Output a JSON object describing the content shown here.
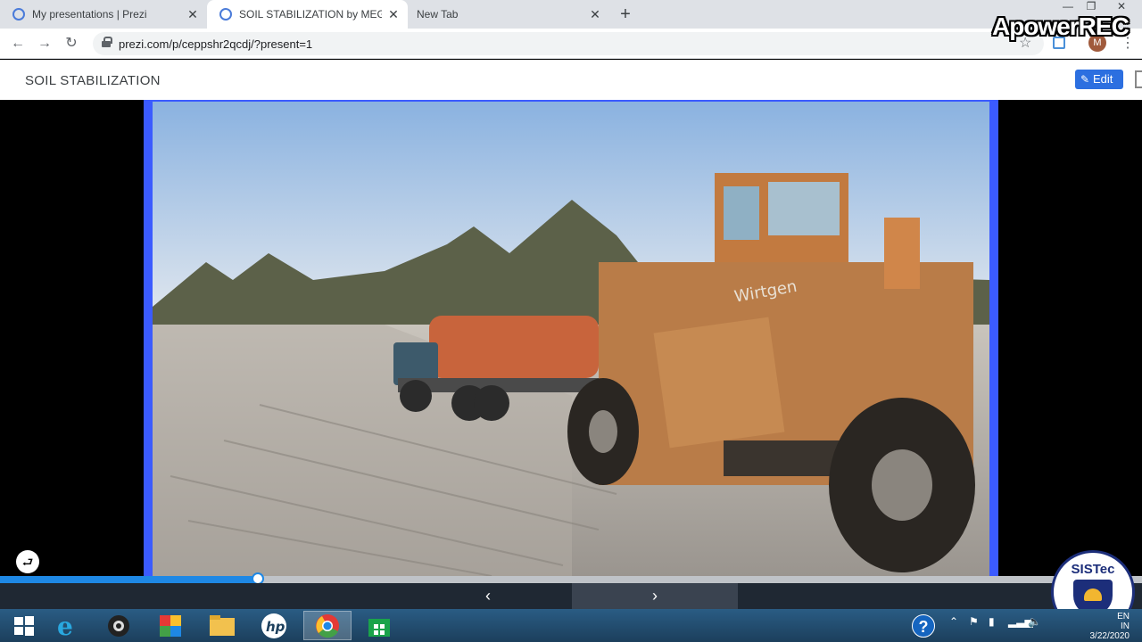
{
  "browser": {
    "tabs": [
      {
        "title": "My presentations | Prezi",
        "icon": "globe-icon",
        "close": "✕"
      },
      {
        "title": "SOIL STABILIZATION by MEGHA",
        "icon": "globe-icon",
        "close": "✕",
        "active": true
      },
      {
        "title": "New Tab",
        "close": "✕"
      }
    ],
    "new_tab_label": "+",
    "window_controls": {
      "minimize": "—",
      "maximize": "❐",
      "close": "✕"
    },
    "url": "prezi.com/p/ceppshr2qcdj/?present=1",
    "profile_initial": "M"
  },
  "watermark": "ApowerREC",
  "prezi": {
    "title": "SOIL STABILIZATION",
    "edit_label": "Edit",
    "progress": 0.226,
    "prev_label": "‹",
    "next_label": "›",
    "slide_image": "soil-stabilizer-machine-and-water-tanker-photo"
  },
  "logo": {
    "text": "SISTec"
  },
  "taskbar": {
    "apps": [
      "windows-start",
      "internet-explorer",
      "webcam",
      "paint",
      "file-explorer",
      "hp",
      "chrome",
      "store"
    ],
    "help": "?",
    "language": "EN",
    "region": "IN",
    "date": "3/22/2020"
  },
  "colors": {
    "accent": "#2c6fe0",
    "slide_border": "#3b5bff",
    "progress": "#1e88e5"
  }
}
